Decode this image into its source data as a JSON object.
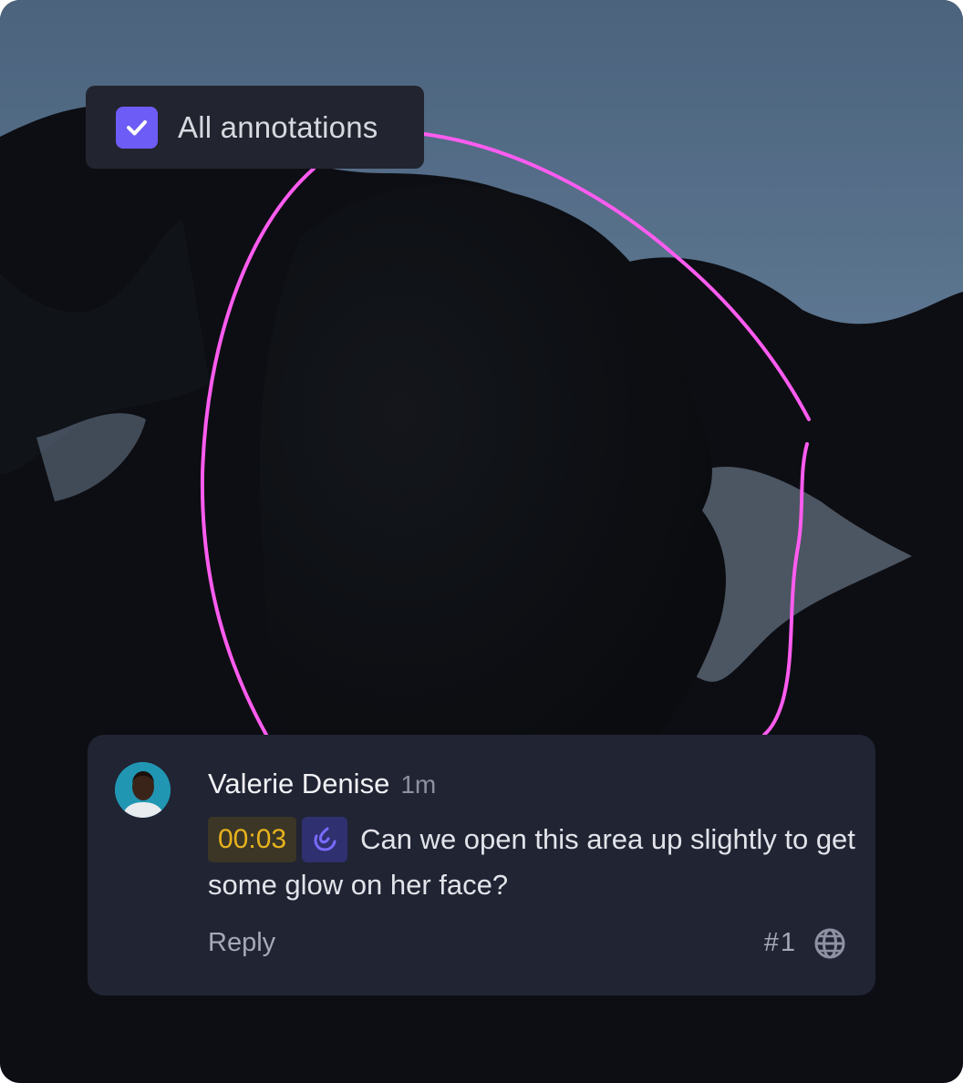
{
  "toolbar": {
    "all_annotations_label": "All annotations",
    "all_annotations_checked": true
  },
  "annotation": {
    "stroke_color": "#ff5cf0"
  },
  "comment": {
    "author": "Valerie Denise",
    "time_ago": "1m",
    "timestamp": "00:03",
    "tool_icon": "annotation-brush-icon",
    "text": "Can we open this area up slightly to get some glow on her face?",
    "reply_label": "Reply",
    "number": "#1",
    "visibility_icon": "globe-icon"
  },
  "colors": {
    "checkbox": "#6d5cf5",
    "timestamp_text": "#e8b21d",
    "timestamp_bg": "#3b3626",
    "card_bg": "#212433"
  }
}
